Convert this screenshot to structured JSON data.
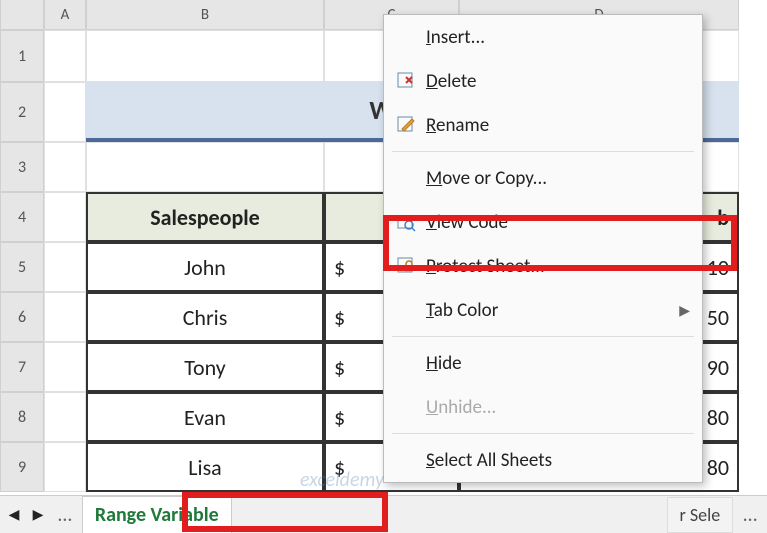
{
  "columns": [
    "",
    "A",
    "B",
    "C",
    "D"
  ],
  "rows": [
    "1",
    "2",
    "3",
    "4",
    "5",
    "6",
    "7",
    "8",
    "9"
  ],
  "title": "With Ra",
  "headers": {
    "b": "Salespeople",
    "d_suffix": "b"
  },
  "table": [
    {
      "name": "John",
      "dollar": "$",
      "val": "10"
    },
    {
      "name": "Chris",
      "dollar": "$",
      "val": "50"
    },
    {
      "name": "Tony",
      "dollar": "$",
      "val": "90"
    },
    {
      "name": "Evan",
      "dollar": "$",
      "val": "80"
    },
    {
      "name": "Lisa",
      "dollar": "$",
      "val": "80"
    }
  ],
  "tab": {
    "active": "Range Variable",
    "other": "r Sele"
  },
  "menu": {
    "insert": "Insert...",
    "delete": "Delete",
    "rename": "Rename",
    "move": "Move or Copy...",
    "viewcode": "View Code",
    "protect": "Protect Sheet...",
    "tabcolor": "Tab Color",
    "hide": "Hide",
    "unhide": "Unhide...",
    "selectall": "Select All Sheets"
  },
  "watermark": "exceldemy"
}
